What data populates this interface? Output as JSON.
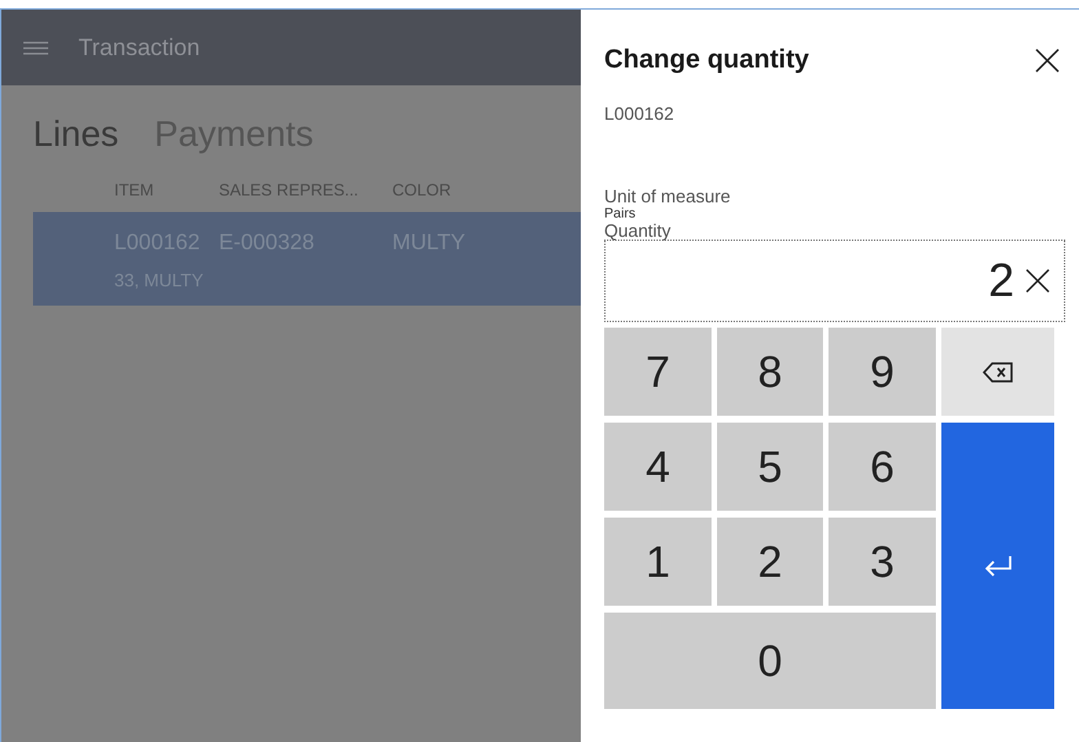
{
  "header": {
    "title": "Transaction"
  },
  "tabs": [
    {
      "label": "Lines",
      "selected": true
    },
    {
      "label": "Payments",
      "selected": false
    }
  ],
  "table": {
    "columns": [
      "ITEM",
      "SALES REPRES...",
      "COLOR"
    ],
    "rows": [
      {
        "cells": [
          "L000162",
          "E-000328",
          "MULTY"
        ],
        "detail": "33, MULTY",
        "selected": true
      }
    ]
  },
  "dialog": {
    "title": "Change quantity",
    "item": "L000162",
    "unit_label": "Unit of measure",
    "unit_value": "Pairs",
    "quantity_label": "Quantity",
    "quantity_value": "2",
    "keys": [
      {
        "kind": "digit",
        "label": "7"
      },
      {
        "kind": "digit",
        "label": "8"
      },
      {
        "kind": "digit",
        "label": "9"
      },
      {
        "kind": "backspace"
      },
      {
        "kind": "digit",
        "label": "4"
      },
      {
        "kind": "digit",
        "label": "5"
      },
      {
        "kind": "digit",
        "label": "6"
      },
      {
        "kind": "enter"
      },
      {
        "kind": "digit",
        "label": "1"
      },
      {
        "kind": "digit",
        "label": "2"
      },
      {
        "kind": "digit",
        "label": "3"
      },
      {
        "kind": "wide",
        "label": "0"
      }
    ]
  }
}
